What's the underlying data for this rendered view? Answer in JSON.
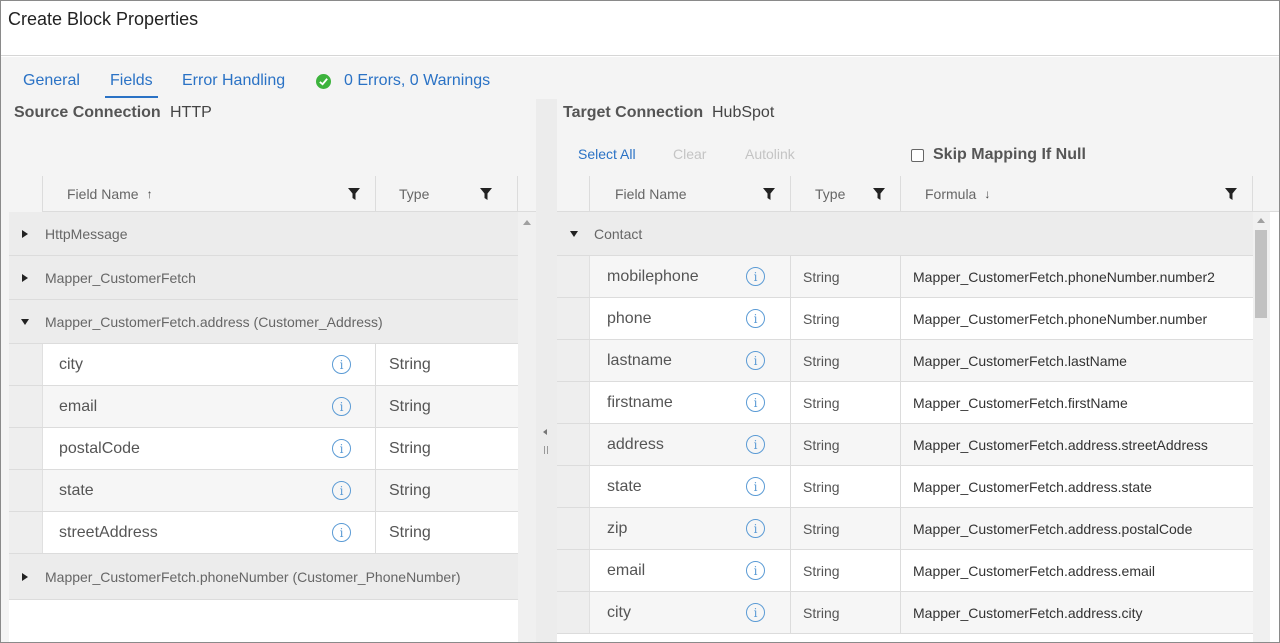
{
  "window": {
    "title": "Create Block Properties"
  },
  "tabs": [
    {
      "label": "General"
    },
    {
      "label": "Fields"
    },
    {
      "label": "Error Handling"
    }
  ],
  "status": {
    "text": "0 Errors, 0 Warnings",
    "color": "#3db33d"
  },
  "source": {
    "label": "Source Connection",
    "value": "HTTP",
    "columns": {
      "field_name": "Field Name",
      "type": "Type"
    },
    "groups": [
      {
        "name": "HttpMessage",
        "expanded": false
      },
      {
        "name": "Mapper_CustomerFetch",
        "expanded": false
      },
      {
        "name": "Mapper_CustomerFetch.address (Customer_Address)",
        "expanded": true
      },
      {
        "name": "Mapper_CustomerFetch.phoneNumber (Customer_PhoneNumber)",
        "expanded": false
      }
    ],
    "fields": [
      {
        "name": "city",
        "type": "String"
      },
      {
        "name": "email",
        "type": "String"
      },
      {
        "name": "postalCode",
        "type": "String"
      },
      {
        "name": "state",
        "type": "String"
      },
      {
        "name": "streetAddress",
        "type": "String"
      }
    ]
  },
  "target": {
    "label": "Target Connection",
    "value": "HubSpot",
    "toolbar": {
      "select_all": "Select All",
      "clear": "Clear",
      "autolink": "Autolink"
    },
    "skip_mapping": "Skip Mapping If Null",
    "columns": {
      "field_name": "Field Name",
      "type": "Type",
      "formula": "Formula"
    },
    "group": "Contact",
    "fields": [
      {
        "name": "mobilephone",
        "type": "String",
        "formula": "Mapper_CustomerFetch.phoneNumber.number2"
      },
      {
        "name": "phone",
        "type": "String",
        "formula": "Mapper_CustomerFetch.phoneNumber.number"
      },
      {
        "name": "lastname",
        "type": "String",
        "formula": "Mapper_CustomerFetch.lastName"
      },
      {
        "name": "firstname",
        "type": "String",
        "formula": "Mapper_CustomerFetch.firstName"
      },
      {
        "name": "address",
        "type": "String",
        "formula": "Mapper_CustomerFetch.address.streetAddress"
      },
      {
        "name": "state",
        "type": "String",
        "formula": "Mapper_CustomerFetch.address.state"
      },
      {
        "name": "zip",
        "type": "String",
        "formula": "Mapper_CustomerFetch.address.postalCode"
      },
      {
        "name": "email",
        "type": "String",
        "formula": "Mapper_CustomerFetch.address.email"
      },
      {
        "name": "city",
        "type": "String",
        "formula": "Mapper_CustomerFetch.address.city"
      }
    ]
  },
  "icons": {
    "info": "info-icon",
    "filter": "filter-icon",
    "status_ok": "check-circle-icon"
  },
  "colors": {
    "accent": "#2a72c5",
    "info": "#5b9bd5"
  }
}
